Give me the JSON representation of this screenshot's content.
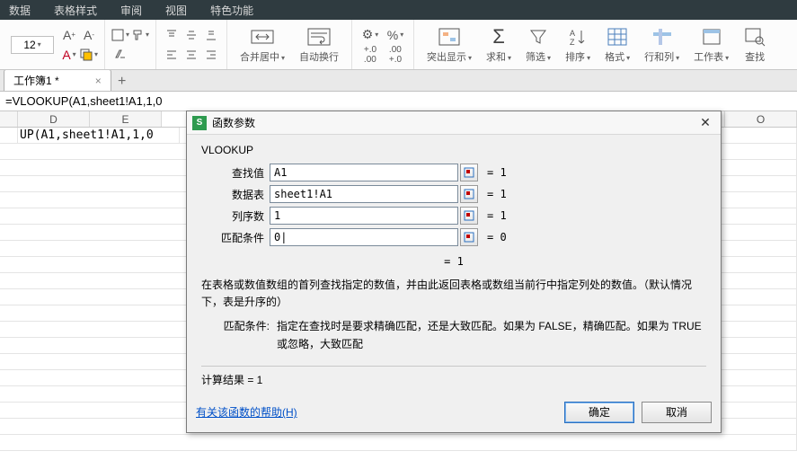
{
  "menu": {
    "items": [
      "数据",
      "表格样式",
      "审阅",
      "视图",
      "特色功能"
    ]
  },
  "ribbon": {
    "font_size": "12",
    "merge_label": "合并居中",
    "wrap_label": "自动换行",
    "groups": {
      "highlight": "突出显示",
      "sum": "求和",
      "filter": "筛选",
      "sort": "排序",
      "format": "格式",
      "rowcol": "行和列",
      "worksheet": "工作表",
      "find": "查找"
    }
  },
  "sheet": {
    "tab_name": "工作簿1 *"
  },
  "formula_bar": "=VLOOKUP(A1,sheet1!A1,1,0",
  "col_headers": [
    "D",
    "E",
    "",
    "",
    "",
    "",
    "",
    "",
    "O"
  ],
  "cells": {
    "a1_visible": "UP(A1,sheet1!A1,1,0"
  },
  "dialog": {
    "title": "函数参数",
    "function_name": "VLOOKUP",
    "params": [
      {
        "label": "查找值",
        "value": "A1",
        "result": "= 1"
      },
      {
        "label": "数据表",
        "value": "sheet1!A1",
        "result": "= 1"
      },
      {
        "label": "列序数",
        "value": "1",
        "result": "= 1"
      },
      {
        "label": "匹配条件",
        "value": "0|",
        "result": "= 0"
      }
    ],
    "overall_result": "= 1",
    "description": "在表格或数值数组的首列查找指定的数值，并由此返回表格或数组当前行中指定列处的数值。（默认情况下，表是升序的）",
    "param_help_label": "匹配条件:",
    "param_help_text": "指定在查找时是要求精确匹配，还是大致匹配。如果为 FALSE，精确匹配。如果为 TRUE 或忽略，大致匹配",
    "calc_result_label": "计算结果 = 1",
    "help_link": "有关该函数的帮助(H)",
    "ok": "确定",
    "cancel": "取消"
  }
}
